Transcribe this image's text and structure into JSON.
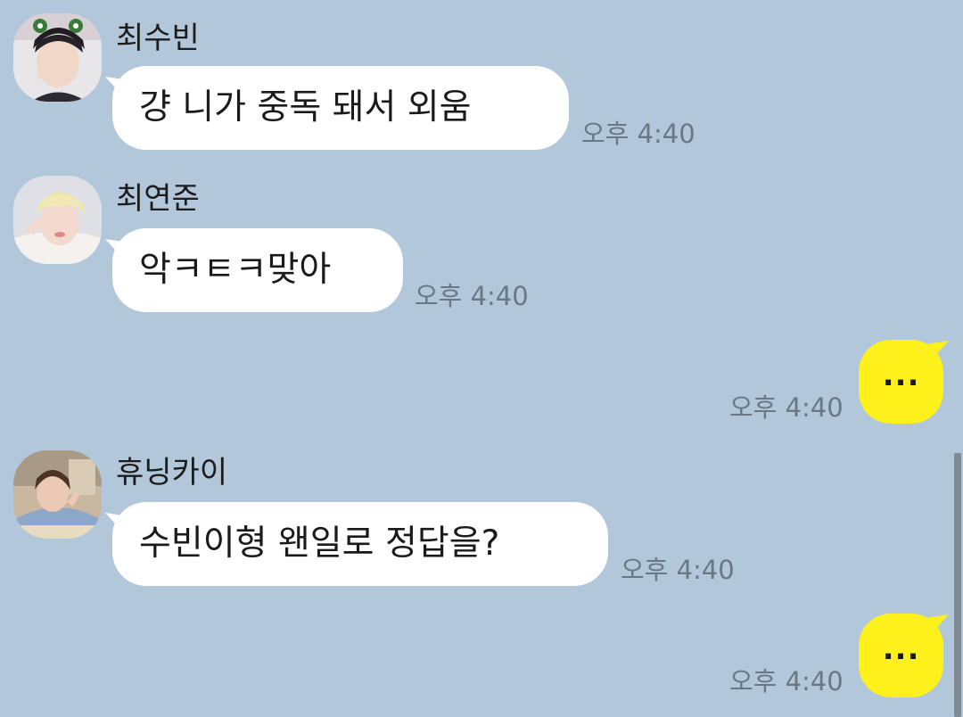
{
  "colors": {
    "background": "#b2c7da",
    "incoming_bubble": "#ffffff",
    "outgoing_bubble": "#fef01b",
    "timestamp": "#6a7885"
  },
  "messages": [
    {
      "sender": "최수빈",
      "text": "걍 니가 중독 돼서 외움",
      "time": "오후 4:40",
      "avatar_icon": "avatar-photo-icon"
    },
    {
      "sender": "최연준",
      "text": "악ㅋㅌㅋ맞아",
      "time": "오후 4:40",
      "avatar_icon": "avatar-photo-icon"
    },
    {
      "sender": "me",
      "text": "...",
      "time": "오후 4:40"
    },
    {
      "sender": "휴닝카이",
      "text": "수빈이형 왠일로 정답을?",
      "time": "오후 4:40",
      "avatar_icon": "avatar-photo-icon"
    },
    {
      "sender": "me",
      "text": "...",
      "time": "오후 4:40"
    }
  ]
}
